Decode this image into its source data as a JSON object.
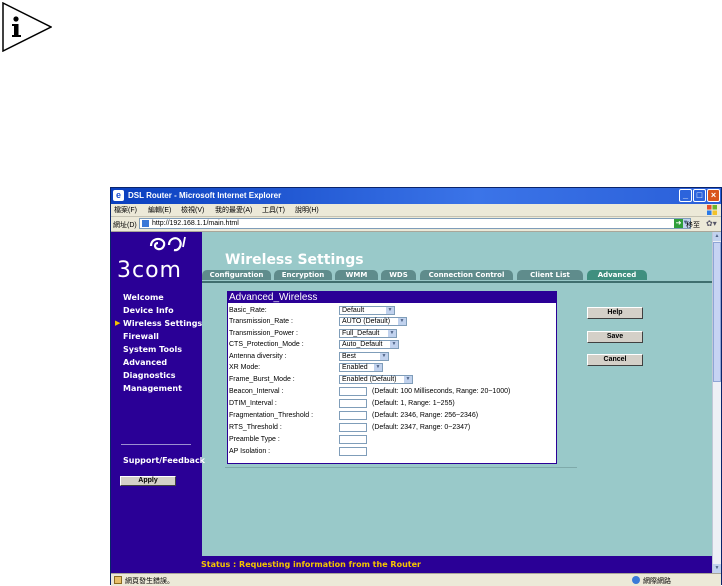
{
  "window": {
    "title": "DSL Router - Microsoft Internet Explorer"
  },
  "menubar": [
    "檔案(F)",
    "編輯(E)",
    "檢視(V)",
    "我的最愛(A)",
    "工具(T)",
    "說明(H)"
  ],
  "address": {
    "label": "網址(D)",
    "url": "http://192.168.1.1/main.html",
    "go_label": "移至"
  },
  "logo": {
    "text": "3com"
  },
  "sidebar": {
    "items": [
      {
        "label": "Welcome"
      },
      {
        "label": "Device Info"
      },
      {
        "label": "Wireless Settings",
        "current": true
      },
      {
        "label": "Firewall"
      },
      {
        "label": "System Tools"
      },
      {
        "label": "Advanced"
      },
      {
        "label": "Diagnostics"
      },
      {
        "label": "Management"
      }
    ],
    "support_label": "Support/Feedback",
    "apply_label": "Apply"
  },
  "page": {
    "title": "Wireless Settings"
  },
  "tabs": [
    {
      "label": "Configuration"
    },
    {
      "label": "Encryption"
    },
    {
      "label": "WMM"
    },
    {
      "label": "WDS"
    },
    {
      "label": "Connection Control"
    },
    {
      "label": "Client List"
    },
    {
      "label": "Advanced",
      "active": true
    }
  ],
  "panel": {
    "heading": "Advanced_Wireless",
    "rows": [
      {
        "label": "Basic_Rate:",
        "value": "Default"
      },
      {
        "label": "Transmission_Rate :",
        "value": "AUTO (Default)"
      },
      {
        "label": "Transmission_Power :",
        "value": "Full_Default"
      },
      {
        "label": "CTS_Protection_Mode :",
        "value": "Auto_Default"
      },
      {
        "label": "Antenna diversity :",
        "value": "Best"
      },
      {
        "label": "XR Mode:",
        "value": "Enabled"
      },
      {
        "label": "Frame_Burst_Mode :",
        "value": "Enabled (Default)"
      },
      {
        "label": "Beacon_Interval :",
        "value": "",
        "hint": "(Default: 100 Milliseconds, Range: 20~1000)"
      },
      {
        "label": "DTIM_Interval :",
        "value": "",
        "hint": "(Default: 1, Range: 1~255)"
      },
      {
        "label": "Fragmentation_Threshold :",
        "value": "",
        "hint": "(Default: 2346, Range: 256~2346)"
      },
      {
        "label": "RTS_Threshold :",
        "value": "",
        "hint": "(Default: 2347, Range: 0~2347)"
      },
      {
        "label": "Preamble Type :",
        "value": ""
      },
      {
        "label": "AP Isolation :",
        "value": ""
      }
    ]
  },
  "buttons": {
    "help": "Help",
    "save": "Save",
    "cancel": "Cancel"
  },
  "status": {
    "text": "Status : Requesting information from the Router"
  },
  "ie_status": {
    "text": "網頁發生錯誤。",
    "zone": "網際網路"
  }
}
